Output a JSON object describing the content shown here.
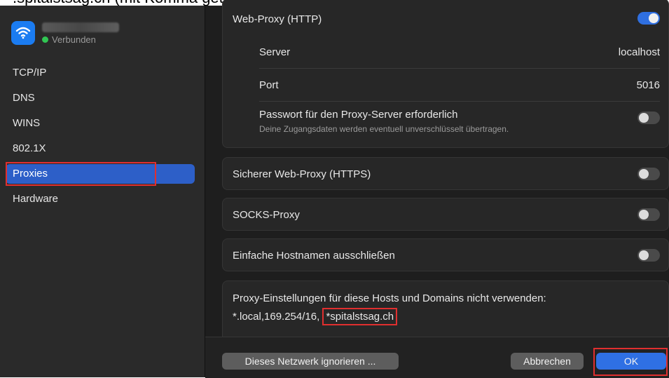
{
  "caption": ".spitalstsag.ch (mit Komma getrennt)",
  "sidebar": {
    "network_status": "Verbunden",
    "items": [
      {
        "label": "TCP/IP"
      },
      {
        "label": "DNS"
      },
      {
        "label": "WINS"
      },
      {
        "label": "802.1X"
      },
      {
        "label": "Proxies"
      },
      {
        "label": "Hardware"
      }
    ]
  },
  "web_proxy": {
    "label": "Web-Proxy (HTTP)",
    "enabled": true,
    "server_label": "Server",
    "server_value": "localhost",
    "port_label": "Port",
    "port_value": "5016",
    "password_label": "Passwort für den Proxy-Server erforderlich",
    "password_sub": "Deine Zugangsdaten werden eventuell unverschlüsselt übertragen.",
    "password_enabled": false
  },
  "https_proxy": {
    "label": "Sicherer Web-Proxy (HTTPS)",
    "enabled": false
  },
  "socks_proxy": {
    "label": "SOCKS-Proxy",
    "enabled": false
  },
  "simple_hostnames": {
    "label": "Einfache Hostnamen ausschließen",
    "enabled": false
  },
  "bypass": {
    "label": "Proxy-Einstellungen für diese Hosts und Domains nicht verwenden:",
    "value_prefix": "*.local,169.254/16, ",
    "value_highlight": "*spitalstsag.ch"
  },
  "footer": {
    "ignore_label": "Dieses Netzwerk ignorieren ...",
    "cancel_label": "Abbrechen",
    "ok_label": "OK"
  },
  "colors": {
    "accent": "#2f70e4",
    "highlight": "#e02f2f",
    "connected": "#31c653"
  }
}
